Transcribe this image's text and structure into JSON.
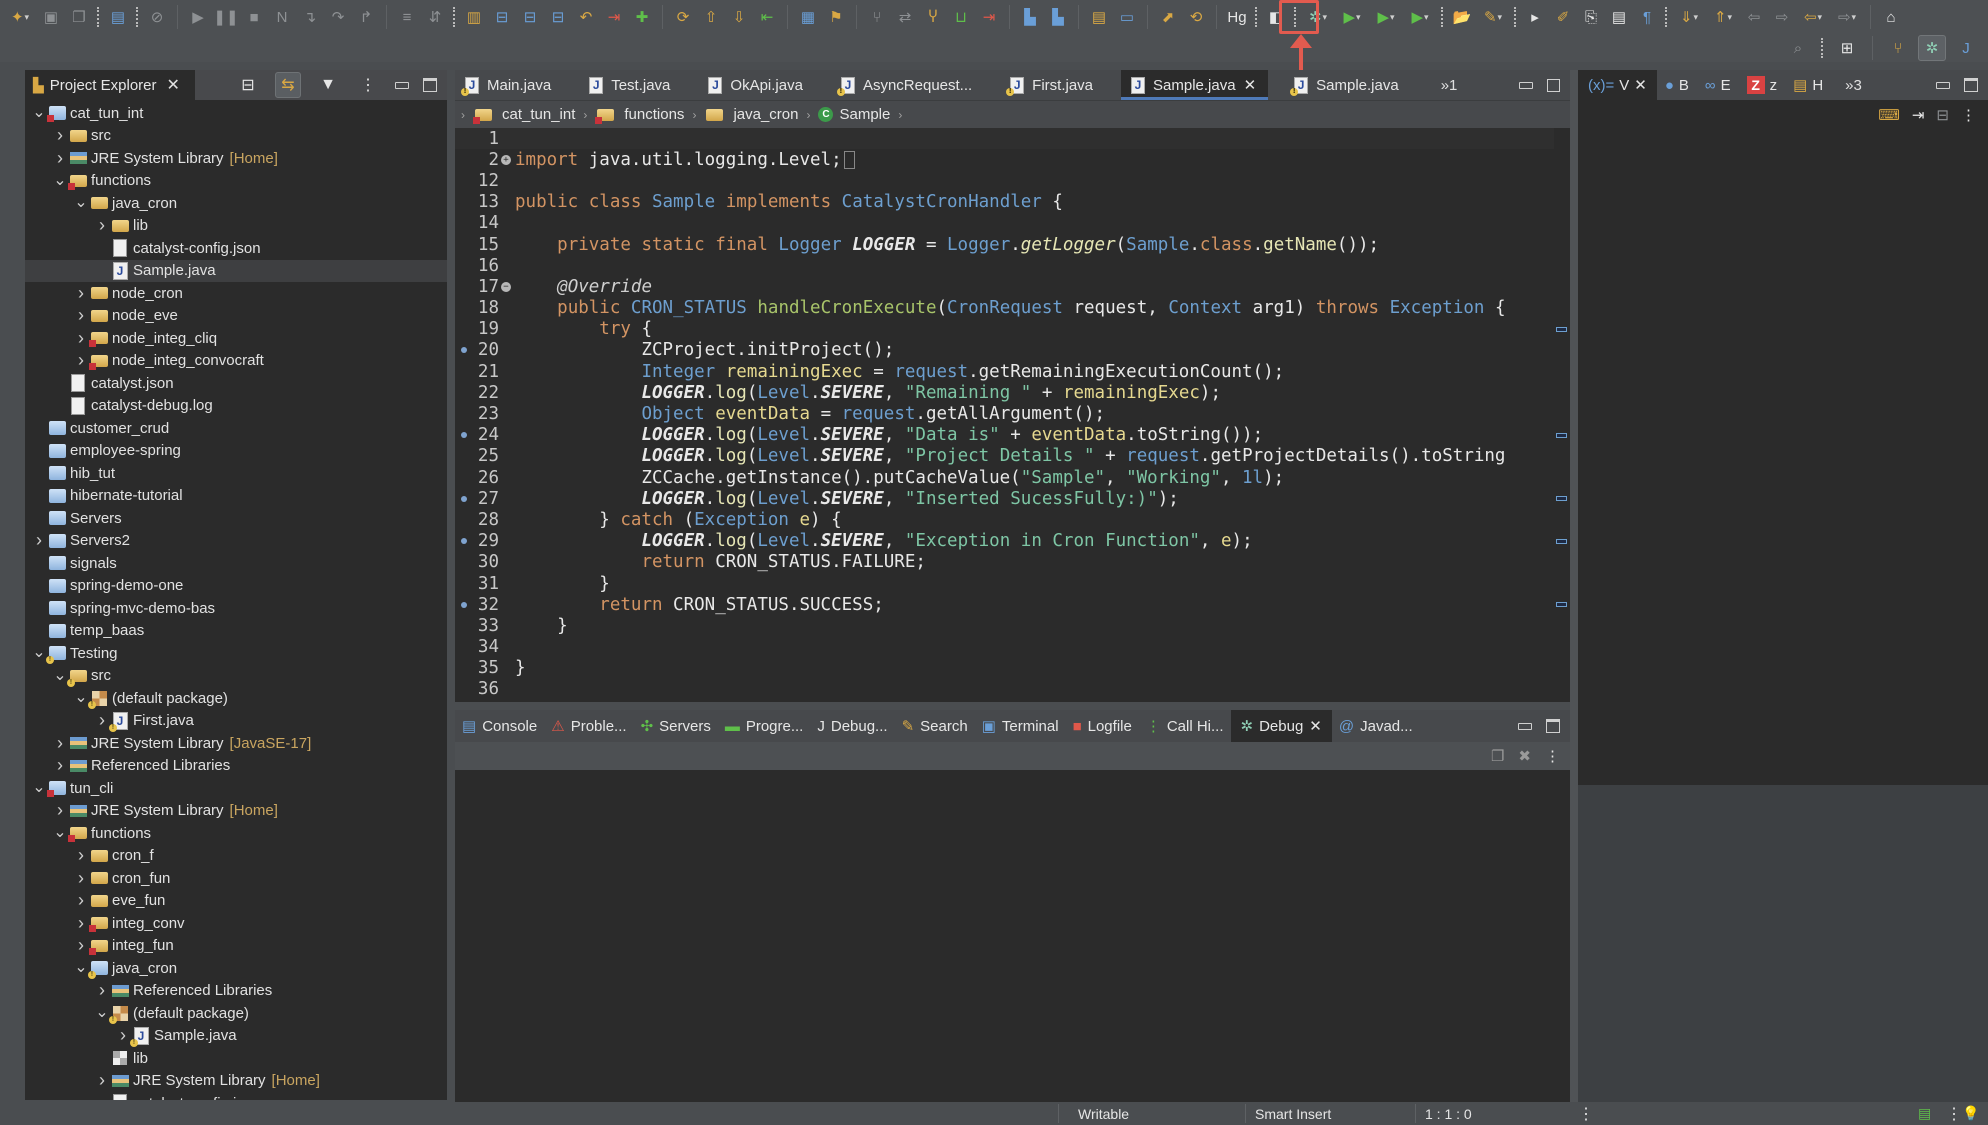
{
  "toolbar": {
    "highlighted_button": "debug-as",
    "highlight_color": "#e25b4f",
    "buttons": [
      {
        "name": "new",
        "glyph": "✦",
        "cls": "c-gold",
        "drop": true
      },
      {
        "name": "save",
        "glyph": "▣",
        "cls": "c-gray"
      },
      {
        "name": "save-all",
        "glyph": "❐",
        "cls": "c-gray"
      },
      {
        "sep": true
      },
      {
        "name": "open-console",
        "glyph": "▤",
        "cls": "c-blue"
      },
      {
        "sep": true
      },
      {
        "name": "skip-breakpoints",
        "glyph": "⊘",
        "cls": "c-gray"
      },
      {
        "vsep": true
      },
      {
        "name": "resume",
        "glyph": "▶",
        "cls": "c-gray"
      },
      {
        "name": "suspend",
        "glyph": "❚❚",
        "cls": "c-gray"
      },
      {
        "name": "terminate",
        "glyph": "■",
        "cls": "c-gray"
      },
      {
        "name": "disconnect",
        "glyph": "N",
        "cls": "c-gray"
      },
      {
        "name": "step-into",
        "glyph": "↴",
        "cls": "c-gray"
      },
      {
        "name": "step-over",
        "glyph": "↷",
        "cls": "c-gray"
      },
      {
        "name": "step-return",
        "glyph": "↱",
        "cls": "c-gray"
      },
      {
        "vsep": true
      },
      {
        "name": "drop-to-frame",
        "glyph": "≡",
        "cls": "c-gray"
      },
      {
        "name": "use-step-filters",
        "glyph": "⇵",
        "cls": "c-gray"
      },
      {
        "sep": true
      },
      {
        "name": "git-repo",
        "glyph": "▥",
        "cls": "c-gold"
      },
      {
        "name": "git-stage",
        "glyph": "⊟",
        "cls": "c-blue"
      },
      {
        "name": "git-unstage",
        "glyph": "⊟",
        "cls": "c-blue"
      },
      {
        "name": "git-commit",
        "glyph": "⊟",
        "cls": "c-blue"
      },
      {
        "name": "git-revert",
        "glyph": "↶",
        "cls": "c-gold"
      },
      {
        "name": "git-reset",
        "glyph": "⇥",
        "cls": "c-red"
      },
      {
        "name": "git-add",
        "glyph": "✚",
        "cls": "c-green"
      },
      {
        "vsep": true
      },
      {
        "name": "git-sync",
        "glyph": "⟳",
        "cls": "c-gold"
      },
      {
        "name": "git-push",
        "glyph": "⇧",
        "cls": "c-gold"
      },
      {
        "name": "git-pull",
        "glyph": "⇩",
        "cls": "c-gold"
      },
      {
        "name": "git-fetch",
        "glyph": "⇤",
        "cls": "c-green"
      },
      {
        "vsep": true
      },
      {
        "name": "git-history",
        "glyph": "▦",
        "cls": "c-blue"
      },
      {
        "name": "git-tag",
        "glyph": "⚑",
        "cls": "c-gold"
      },
      {
        "vsep": true
      },
      {
        "name": "git-branch",
        "glyph": "⑂",
        "cls": "c-gray"
      },
      {
        "name": "git-switch",
        "glyph": "⇄",
        "cls": "c-gray"
      },
      {
        "name": "git-merge",
        "glyph": "Ⴤ",
        "cls": "c-gold"
      },
      {
        "name": "git-rebase",
        "glyph": "⊔",
        "cls": "c-green"
      },
      {
        "name": "git-checkout",
        "glyph": "⇥",
        "cls": "c-red"
      },
      {
        "vsep": true
      },
      {
        "name": "new-class",
        "glyph": "▙",
        "cls": "c-blue"
      },
      {
        "name": "new-interface",
        "glyph": "▙",
        "cls": "c-blue"
      },
      {
        "vsep": true
      },
      {
        "name": "open-type",
        "glyph": "▤",
        "cls": "c-gold"
      },
      {
        "name": "open-task",
        "glyph": "▭",
        "cls": "c-blue"
      },
      {
        "vsep": true
      },
      {
        "name": "publish",
        "glyph": "⬈",
        "cls": "c-gold"
      },
      {
        "name": "refresh-server",
        "glyph": "⟲",
        "cls": "c-gold"
      },
      {
        "vsep": true
      },
      {
        "name": "mercurial",
        "glyph": "Hg",
        "cls": "c-white"
      },
      {
        "sep": true
      },
      {
        "name": "catalyst",
        "glyph": "◧",
        "cls": "c-white"
      },
      {
        "sep": true
      },
      {
        "name": "debug-as",
        "glyph": "✲",
        "cls": "c-teal",
        "drop": true
      },
      {
        "name": "run-as",
        "glyph": "▶",
        "cls": "c-green",
        "drop": true
      },
      {
        "name": "run-coverage",
        "glyph": "▶",
        "cls": "c-green",
        "drop": true
      },
      {
        "name": "run-external",
        "glyph": "▶",
        "cls": "c-green",
        "drop": true
      },
      {
        "sep": true
      },
      {
        "name": "open-folder",
        "glyph": "📂",
        "cls": "c-gold"
      },
      {
        "name": "search",
        "glyph": "✎",
        "cls": "c-gold",
        "drop": true
      },
      {
        "sep": true
      },
      {
        "name": "toggle-breadcrumb",
        "glyph": "▸",
        "cls": "c-white"
      },
      {
        "name": "toggle-mark-occurrences",
        "glyph": "✐",
        "cls": "c-gold"
      },
      {
        "name": "toggle-block-select",
        "glyph": "⎘",
        "cls": "c-white"
      },
      {
        "name": "toggle-word-wrap",
        "glyph": "▤",
        "cls": "c-white"
      },
      {
        "name": "show-whitespace",
        "glyph": "¶",
        "cls": "c-blue"
      },
      {
        "sep": true
      },
      {
        "name": "next-annotation",
        "glyph": "⇓",
        "cls": "c-gold",
        "drop": true
      },
      {
        "name": "previous-annotation",
        "glyph": "⇑",
        "cls": "c-gold",
        "drop": true
      },
      {
        "name": "last-edit-back",
        "glyph": "⇦",
        "cls": "c-gray"
      },
      {
        "name": "last-edit-forward",
        "glyph": "⇨",
        "cls": "c-gray"
      },
      {
        "name": "back",
        "glyph": "⇦",
        "cls": "c-gold",
        "drop": true
      },
      {
        "name": "forward",
        "glyph": "⇨",
        "cls": "c-gray",
        "drop": true
      },
      {
        "vsep": true
      },
      {
        "name": "pin-editor",
        "glyph": "⌂",
        "cls": "c-white"
      }
    ],
    "row2": [
      {
        "name": "search",
        "glyph": "⌕",
        "cls": "c-gray"
      },
      {
        "sep": true
      },
      {
        "name": "open-perspective",
        "glyph": "⊞",
        "cls": "c-white"
      },
      {
        "vsep": true
      },
      {
        "name": "perspective-git",
        "glyph": "⑂",
        "cls": "c-gold"
      },
      {
        "name": "perspective-debug",
        "glyph": "✲",
        "cls": "c-teal",
        "active": true
      },
      {
        "name": "perspective-java",
        "glyph": "J",
        "cls": "c-blue"
      }
    ]
  },
  "explorer": {
    "title": "Project Explorer",
    "tree": [
      {
        "depth": 0,
        "tw": "v",
        "icon": "proj err",
        "label": "cat_tun_int"
      },
      {
        "depth": 1,
        "tw": ">",
        "icon": "folder",
        "label": "src"
      },
      {
        "depth": 1,
        "tw": ">",
        "icon": "lib",
        "label": "JRE System Library",
        "dec": "[Home]"
      },
      {
        "depth": 1,
        "tw": "v",
        "icon": "folder err",
        "label": "functions"
      },
      {
        "depth": 2,
        "tw": "v",
        "icon": "folder",
        "label": "java_cron"
      },
      {
        "depth": 3,
        "tw": ">",
        "icon": "folder",
        "label": "lib"
      },
      {
        "depth": 3,
        "tw": "",
        "icon": "file",
        "label": "catalyst-config.json"
      },
      {
        "depth": 3,
        "tw": "",
        "icon": "java",
        "label": "Sample.java",
        "selected": true
      },
      {
        "depth": 2,
        "tw": ">",
        "icon": "folder",
        "label": "node_cron"
      },
      {
        "depth": 2,
        "tw": ">",
        "icon": "folder",
        "label": "node_eve"
      },
      {
        "depth": 2,
        "tw": ">",
        "icon": "folder err",
        "label": "node_integ_cliq"
      },
      {
        "depth": 2,
        "tw": ">",
        "icon": "folder err",
        "label": "node_integ_convocraft"
      },
      {
        "depth": 1,
        "tw": "",
        "icon": "file",
        "label": "catalyst.json"
      },
      {
        "depth": 1,
        "tw": "",
        "icon": "file",
        "label": "catalyst-debug.log"
      },
      {
        "depth": 0,
        "tw": "",
        "icon": "proj",
        "label": "customer_crud"
      },
      {
        "depth": 0,
        "tw": "",
        "icon": "proj",
        "label": "employee-spring"
      },
      {
        "depth": 0,
        "tw": "",
        "icon": "proj",
        "label": "hib_tut"
      },
      {
        "depth": 0,
        "tw": "",
        "icon": "proj",
        "label": "hibernate-tutorial"
      },
      {
        "depth": 0,
        "tw": "",
        "icon": "proj",
        "label": "Servers"
      },
      {
        "depth": 0,
        "tw": ">",
        "icon": "proj",
        "label": "Servers2"
      },
      {
        "depth": 0,
        "tw": "",
        "icon": "proj",
        "label": "signals"
      },
      {
        "depth": 0,
        "tw": "",
        "icon": "proj",
        "label": "spring-demo-one"
      },
      {
        "depth": 0,
        "tw": "",
        "icon": "proj",
        "label": "spring-mvc-demo-bas"
      },
      {
        "depth": 0,
        "tw": "",
        "icon": "proj",
        "label": "temp_baas"
      },
      {
        "depth": 0,
        "tw": "v",
        "icon": "proj warn",
        "label": "Testing"
      },
      {
        "depth": 1,
        "tw": "v",
        "icon": "folder warn",
        "label": "src"
      },
      {
        "depth": 2,
        "tw": "v",
        "icon": "pkg warn",
        "label": "(default package)"
      },
      {
        "depth": 3,
        "tw": ">",
        "icon": "java warn",
        "label": "First.java"
      },
      {
        "depth": 1,
        "tw": ">",
        "icon": "lib",
        "label": "JRE System Library",
        "dec": "[JavaSE-17]"
      },
      {
        "depth": 1,
        "tw": ">",
        "icon": "lib",
        "label": "Referenced Libraries"
      },
      {
        "depth": 0,
        "tw": "v",
        "icon": "proj err",
        "label": "tun_cli"
      },
      {
        "depth": 1,
        "tw": ">",
        "icon": "lib",
        "label": "JRE System Library",
        "dec": "[Home]"
      },
      {
        "depth": 1,
        "tw": "v",
        "icon": "folder err",
        "label": "functions"
      },
      {
        "depth": 2,
        "tw": ">",
        "icon": "folder",
        "label": "cron_f"
      },
      {
        "depth": 2,
        "tw": ">",
        "icon": "folder",
        "label": "cron_fun"
      },
      {
        "depth": 2,
        "tw": ">",
        "icon": "folder",
        "label": "eve_fun"
      },
      {
        "depth": 2,
        "tw": ">",
        "icon": "folder err",
        "label": "integ_conv"
      },
      {
        "depth": 2,
        "tw": ">",
        "icon": "folder err",
        "label": "integ_fun"
      },
      {
        "depth": 2,
        "tw": "v",
        "icon": "proj warn",
        "label": "java_cron"
      },
      {
        "depth": 3,
        "tw": ">",
        "icon": "lib",
        "label": "Referenced Libraries"
      },
      {
        "depth": 3,
        "tw": "v",
        "icon": "pkg warn",
        "label": "(default package)"
      },
      {
        "depth": 4,
        "tw": ">",
        "icon": "java warn",
        "label": "Sample.java"
      },
      {
        "depth": 3,
        "tw": "",
        "icon": "libdir",
        "label": "lib"
      },
      {
        "depth": 3,
        "tw": ">",
        "icon": "lib",
        "label": "JRE System Library",
        "dec": "[Home]"
      },
      {
        "depth": 3,
        "tw": "",
        "icon": "file",
        "label": "catalyst-config.json"
      }
    ]
  },
  "editor": {
    "tabs": [
      {
        "label": "Main.java",
        "warn": true
      },
      {
        "label": "Test.java"
      },
      {
        "label": "OkApi.java"
      },
      {
        "label": "AsyncRequest...",
        "warn": true
      },
      {
        "label": "First.java",
        "warn": true
      },
      {
        "label": "Sample.java",
        "active": true
      },
      {
        "label": "Sample.java",
        "warn": true
      }
    ],
    "overflow_label": "»1",
    "breadcrumb": [
      "cat_tun_int",
      "functions",
      "java_cron",
      "Sample"
    ],
    "lines": [
      {
        "n": "1",
        "html": ""
      },
      {
        "n": "2",
        "fold": "+",
        "html": "<span class='kw'>import</span> java.util.logging.Level;<span class='fold-box'></span>"
      },
      {
        "n": "12",
        "html": ""
      },
      {
        "n": "13",
        "html": "<span class='kw'>public class</span> <span class='ty'>Sample</span> <span class='kw'>implements</span> <span class='ty'>CatalystCronHandler</span> {"
      },
      {
        "n": "14",
        "html": ""
      },
      {
        "n": "15",
        "html": "    <span class='kw'>private static final</span> <span class='ty'>Logger</span> <span class='lg'>LOGGER</span> = <span class='ty'>Logger</span>.<span class='mth it'>getLogger</span>(<span class='ty'>Sample</span>.<span class='kw'>class</span>.<span class='mth'>getName</span>());"
      },
      {
        "n": "16",
        "html": ""
      },
      {
        "n": "17",
        "fold": "-",
        "html": "    <span class='an'>@Override</span>"
      },
      {
        "n": "18",
        "html": "    <span class='kw'>public</span> <span class='ty'>CRON_STATUS</span> <span class='fn'>handleCronExecute</span>(<span class='ty'>CronRequest</span> request, <span class='ty'>Context</span> arg1) <span class='kw'>throws</span> <span class='ty'>Exception</span> {"
      },
      {
        "n": "19",
        "html": "        <span class='kw'>try</span> {"
      },
      {
        "n": "20",
        "bm": true,
        "html": "            ZCProject.initProject();"
      },
      {
        "n": "21",
        "html": "            <span class='ty'>Integer</span> <span class='va'>remainingExec</span> = <span class='ty'>request</span>.getRemainingExecutionCount();"
      },
      {
        "n": "22",
        "html": "            <span class='lg'>LOGGER</span>.<span class='mth'>log</span>(<span class='ty'>Level</span>.<span class='en'>SEVERE</span>, <span class='st'>\"Remaining \"</span> + <span class='va'>remainingExec</span>);"
      },
      {
        "n": "23",
        "html": "            <span class='ty'>Object</span> <span class='va'>eventData</span> = <span class='ty'>request</span>.getAllArgument();"
      },
      {
        "n": "24",
        "bm": true,
        "html": "            <span class='lg'>LOGGER</span>.<span class='mth'>log</span>(<span class='ty'>Level</span>.<span class='en'>SEVERE</span>, <span class='st'>\"Data is\"</span> + <span class='va'>eventData</span>.toString());"
      },
      {
        "n": "25",
        "html": "            <span class='lg'>LOGGER</span>.<span class='mth'>log</span>(<span class='ty'>Level</span>.<span class='en'>SEVERE</span>, <span class='st'>\"Project Details \"</span> + <span class='ty'>request</span>.getProjectDetails().toString"
      },
      {
        "n": "26",
        "html": "            ZCCache.getInstance().putCacheValue(<span class='st'>\"Sample\"</span>, <span class='st'>\"Working\"</span>, <span class='ty'>1l</span>);"
      },
      {
        "n": "27",
        "bm": true,
        "html": "            <span class='lg'>LOGGER</span>.<span class='mth'>log</span>(<span class='ty'>Level</span>.<span class='en'>SEVERE</span>, <span class='st'>\"Inserted SucessFully:)\"</span>);"
      },
      {
        "n": "28",
        "html": "        } <span class='kw'>catch</span> (<span class='ty'>Exception</span> <span class='va'>e</span>) {"
      },
      {
        "n": "29",
        "bm": true,
        "html": "            <span class='lg'>LOGGER</span>.<span class='mth'>log</span>(<span class='ty'>Level</span>.<span class='en'>SEVERE</span>, <span class='st'>\"Exception in Cron Function\"</span>, <span class='va'>e</span>);"
      },
      {
        "n": "30",
        "html": "            <span class='kw'>return</span> CRON_STATUS.FAILURE;"
      },
      {
        "n": "31",
        "html": "        }"
      },
      {
        "n": "32",
        "bm": true,
        "html": "        <span class='kw'>return</span> CRON_STATUS.SUCCESS;"
      },
      {
        "n": "33",
        "html": "    }"
      },
      {
        "n": "34",
        "html": ""
      },
      {
        "n": "35",
        "html": "}"
      },
      {
        "n": "36",
        "html": ""
      }
    ],
    "overview_marks": [
      9,
      14,
      17,
      19,
      22
    ]
  },
  "bottom_panel": {
    "tabs": [
      {
        "label": "Console",
        "icon": "▤",
        "cls": "c-blue",
        "name": "console"
      },
      {
        "label": "Proble...",
        "icon": "⚠",
        "cls": "c-red",
        "name": "problems"
      },
      {
        "label": "Servers",
        "icon": "✣",
        "cls": "c-green",
        "name": "servers"
      },
      {
        "label": "Progre...",
        "icon": "▬",
        "cls": "c-green",
        "name": "progress"
      },
      {
        "label": "Debug...",
        "icon": "J",
        "cls": "c-white",
        "name": "debug-shell"
      },
      {
        "label": "Search",
        "icon": "✎",
        "cls": "c-gold",
        "name": "search"
      },
      {
        "label": "Terminal",
        "icon": "▣",
        "cls": "c-blue",
        "name": "terminal"
      },
      {
        "label": "Logfile",
        "icon": "■",
        "cls": "c-red",
        "name": "logfile"
      },
      {
        "label": "Call Hi...",
        "icon": "⋮",
        "cls": "c-green",
        "name": "call-hierarchy"
      },
      {
        "label": "Debug",
        "icon": "✲",
        "cls": "c-teal",
        "name": "debug",
        "active": true
      },
      {
        "label": "Javad...",
        "icon": "@",
        "cls": "c-blue",
        "name": "javadoc"
      }
    ]
  },
  "right_panel": {
    "tabs": [
      {
        "label": "V",
        "icon": "(x)=",
        "cls": "c-blue",
        "name": "variables",
        "active": true
      },
      {
        "label": "B",
        "icon": "●",
        "cls": "c-blue",
        "name": "breakpoints"
      },
      {
        "label": "E",
        "icon": "∞",
        "cls": "c-blue",
        "name": "expressions"
      },
      {
        "label": "z",
        "icon": "Z",
        "cls": "zbadge",
        "name": "zoho"
      },
      {
        "label": "H",
        "icon": "▤",
        "cls": "c-gold",
        "name": "history"
      }
    ],
    "overflow_label": "»3"
  },
  "statusbar": {
    "writable": "Writable",
    "insert_mode": "Smart Insert",
    "position": "1 : 1 : 0"
  }
}
